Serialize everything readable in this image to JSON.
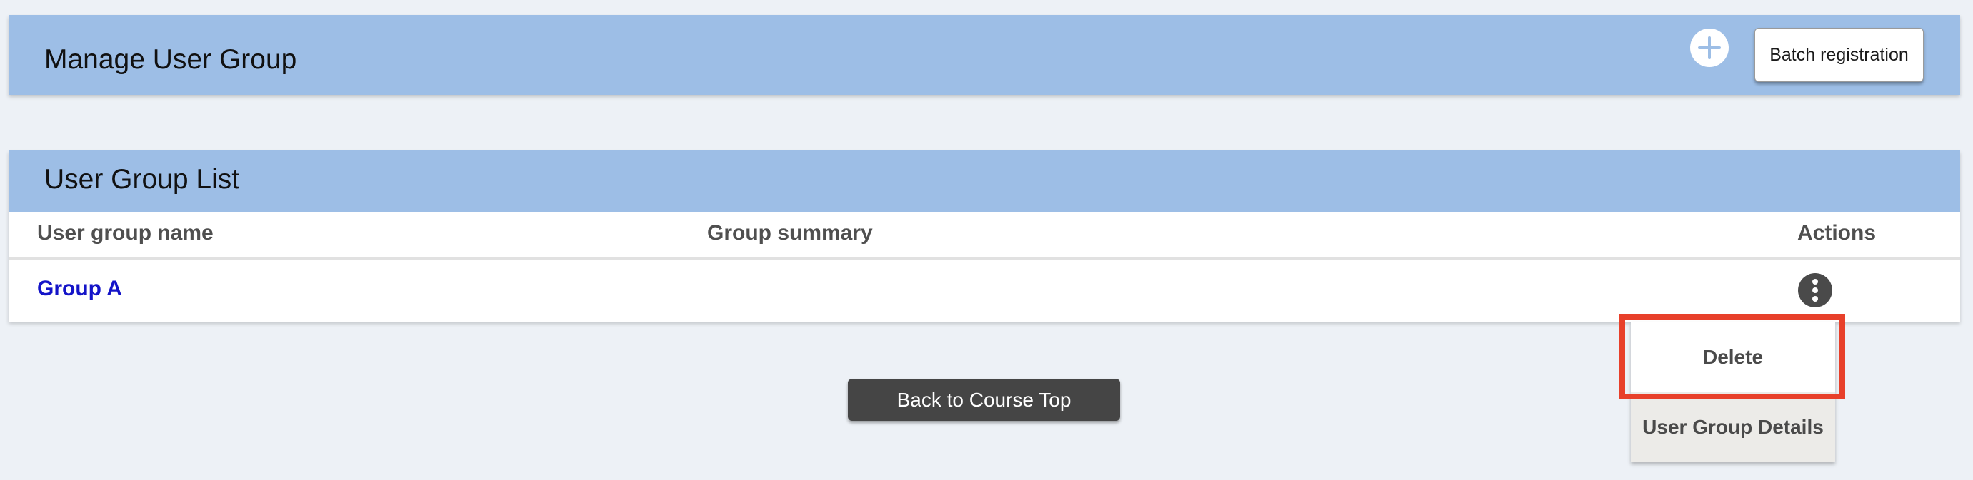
{
  "header": {
    "title": "Manage User Group",
    "add_icon": "plus-circle-icon",
    "batch_button_label": "Batch registration"
  },
  "list": {
    "title": "User Group List",
    "columns": [
      "User group name",
      "Group summary",
      "Actions"
    ],
    "rows": [
      {
        "name": "Group A",
        "summary": "",
        "actions_icon": "more-vertical-icon"
      }
    ]
  },
  "actions_menu": {
    "items": [
      "Delete",
      "User Group Details"
    ],
    "highlighted": "Delete"
  },
  "footer": {
    "back_button_label": "Back to Course Top"
  },
  "colors": {
    "header_bg": "#9dbee6",
    "page_bg": "#edf1f6",
    "link": "#1414c8",
    "dark_button": "#454545",
    "highlight": "#e8402a"
  }
}
